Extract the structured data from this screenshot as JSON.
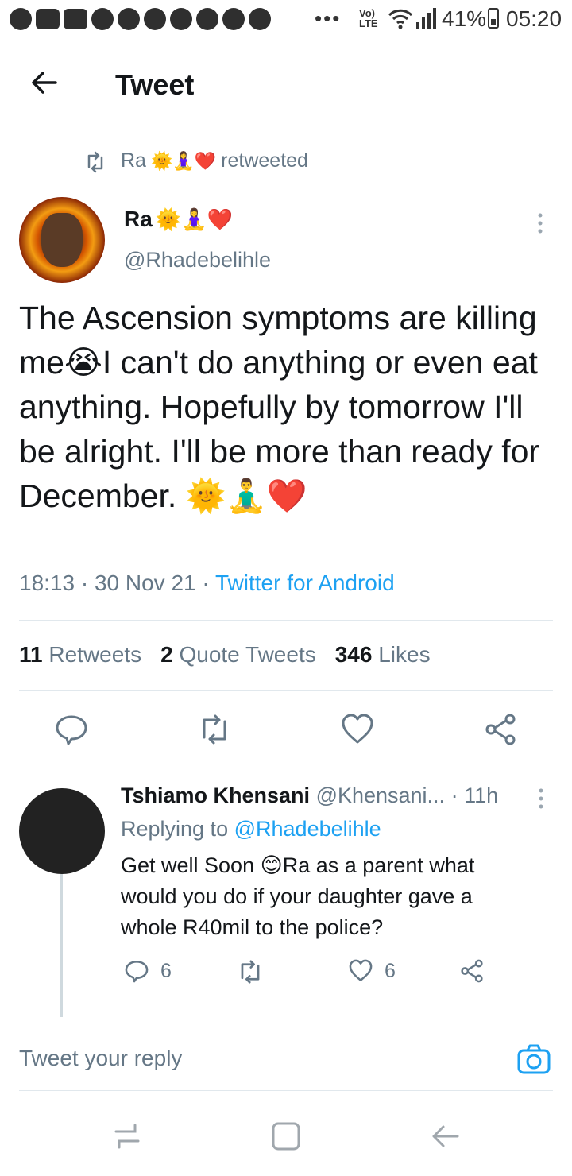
{
  "status_bar": {
    "network": "LTE",
    "battery": "41%",
    "time": "05:20",
    "notification_icons": [
      "facebook-icon",
      "youtube-icon",
      "youtube-icon",
      "app-icon",
      "app-icon",
      "app-icon",
      "app-icon",
      "app-icon",
      "app-icon",
      "app-icon"
    ]
  },
  "header": {
    "title": "Tweet"
  },
  "retweet_banner": {
    "name": "Ra",
    "suffix": "retweeted",
    "emojis": "🌞🧘‍♀️❤️"
  },
  "tweet": {
    "display_name": "Ra",
    "name_emojis": "🌞🧘‍♀️❤️",
    "handle": "@Rhadebelihle",
    "text": "The Ascension symptoms are killing me😭I can't do anything or even eat anything. Hopefully by tomorrow I'll be alright. I'll be more than ready for December. 🌞🧘‍♂️❤️",
    "time": "18:13",
    "date": "30 Nov 21",
    "source": "Twitter for Android",
    "stats": {
      "retweets_count": "11",
      "retweets_label": "Retweets",
      "quotes_count": "2",
      "quotes_label": "Quote Tweets",
      "likes_count": "346",
      "likes_label": "Likes"
    }
  },
  "reply": {
    "name": "Tshiamo Khensani",
    "handle": "@Khensani...",
    "age": "· 11h",
    "replying_prefix": "Replying to",
    "replying_to": "@Rhadebelihle",
    "text": "Get well Soon 😊Ra as a parent what would you do if your daughter gave a whole R40mil to the police?",
    "reply_count": "6",
    "like_count": "6"
  },
  "composer": {
    "placeholder": "Tweet your reply"
  },
  "colors": {
    "accent": "#1da1f2",
    "muted": "#657786",
    "text": "#14171a",
    "divider": "#e1e8ed"
  }
}
